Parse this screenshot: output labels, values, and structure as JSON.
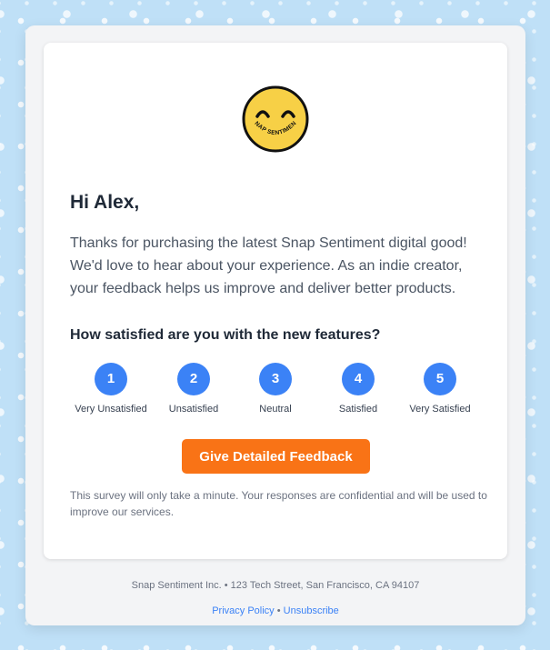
{
  "brand": {
    "logo_text": "SNAP SENTIMENT",
    "logo_color": "#f7d046"
  },
  "email": {
    "greeting": "Hi Alex,",
    "body": "Thanks for purchasing the latest Snap Sentiment digital good! We'd love to hear about your experience. As an indie creator, your feedback helps us improve and deliver better products.",
    "question": "How satisfied are you with the new features?",
    "ratings": [
      {
        "value": "1",
        "label": "Very Unsatisfied"
      },
      {
        "value": "2",
        "label": "Unsatisfied"
      },
      {
        "value": "3",
        "label": "Neutral"
      },
      {
        "value": "4",
        "label": "Satisfied"
      },
      {
        "value": "5",
        "label": "Very Satisfied"
      }
    ],
    "cta_label": "Give Detailed Feedback",
    "note": "This survey will only take a minute. Your responses are confidential and will be used to improve our services."
  },
  "footer": {
    "address": "Snap Sentiment Inc. • 123 Tech Street, San Francisco, CA 94107",
    "privacy_label": "Privacy Policy",
    "separator": "•",
    "unsubscribe_label": "Unsubscribe"
  },
  "colors": {
    "accent_blue": "#3b82f6",
    "cta_orange": "#f97316"
  }
}
